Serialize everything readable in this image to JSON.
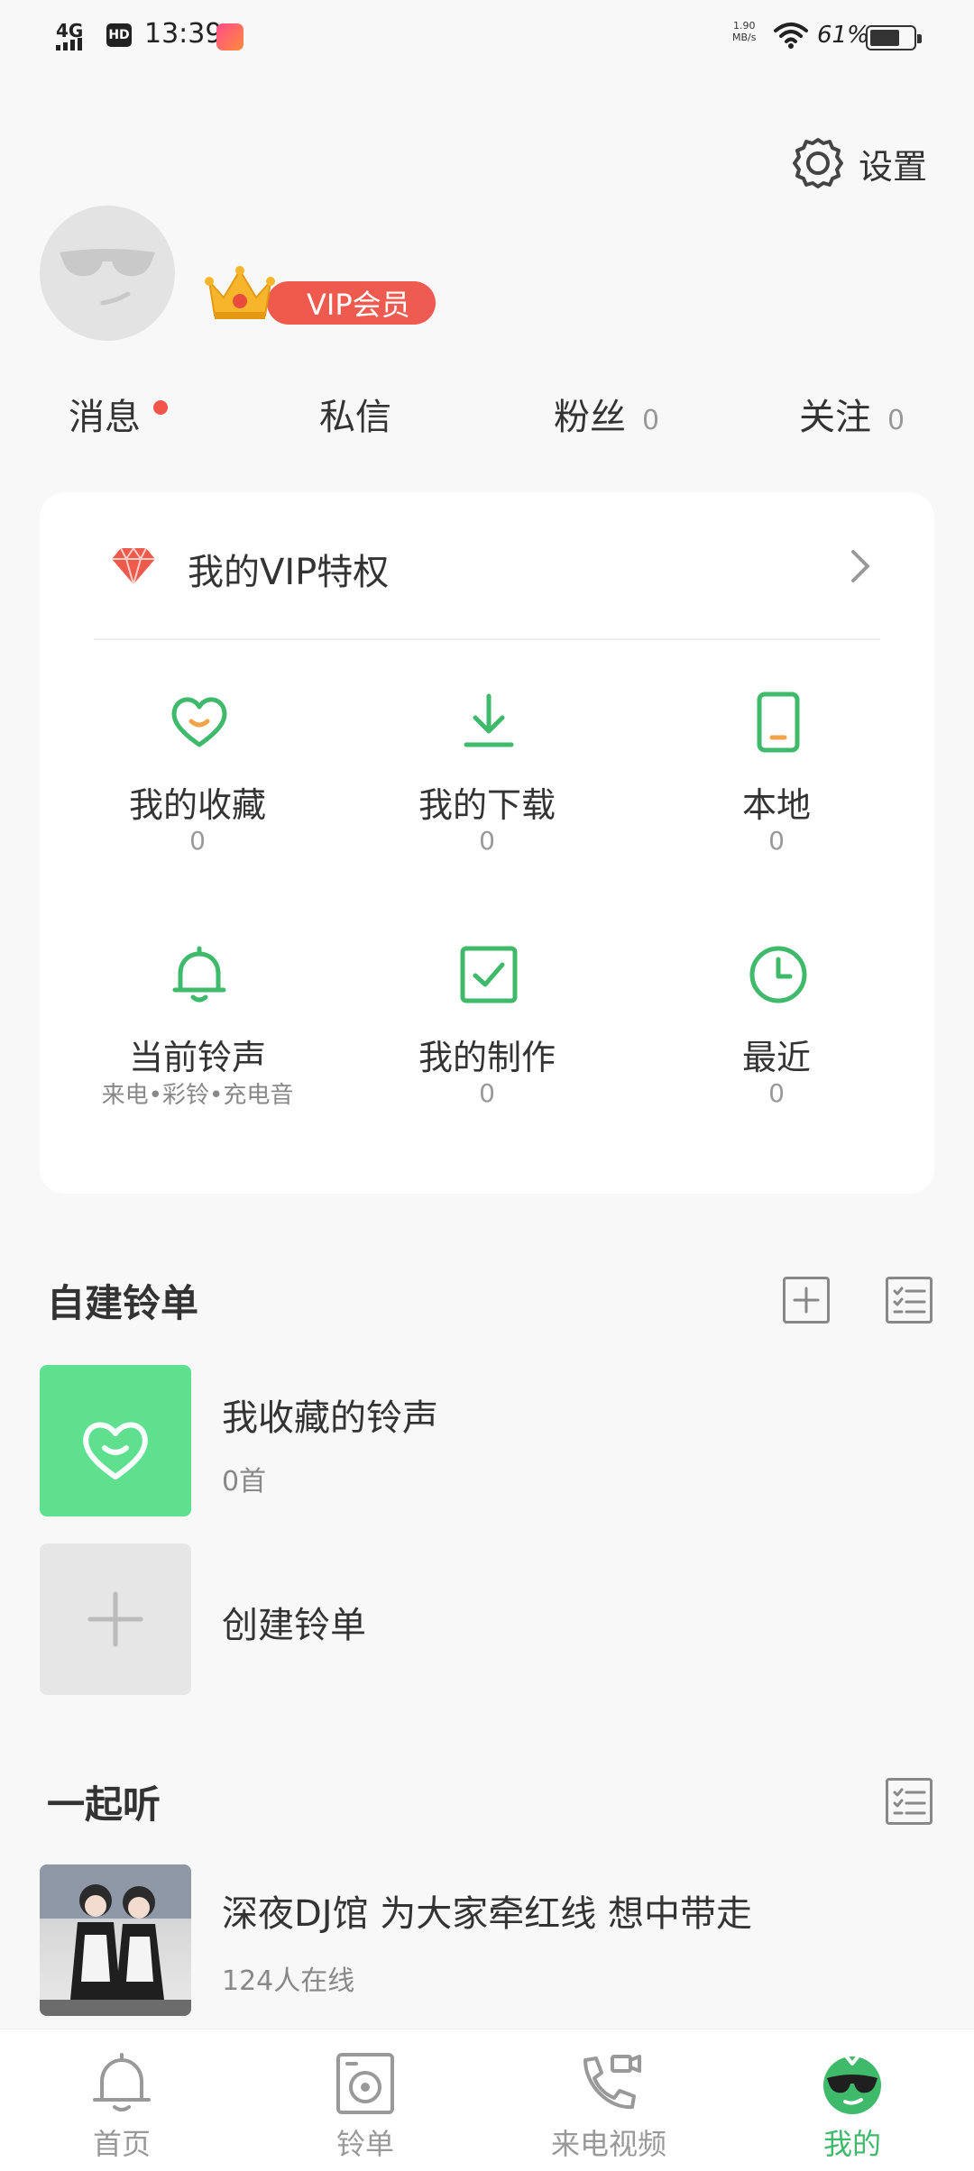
{
  "status_bar": {
    "network": "4G",
    "hd_label": "HD",
    "time": "13:39",
    "speed_value": "1.90",
    "speed_unit": "MB/s",
    "battery_pct": "61%"
  },
  "header": {
    "settings_label": "设置",
    "vip_label": "VIP会员"
  },
  "stats": [
    {
      "label": "消息",
      "count": ""
    },
    {
      "label": "私信",
      "count": ""
    },
    {
      "label": "粉丝",
      "count": "0"
    },
    {
      "label": "关注",
      "count": "0"
    }
  ],
  "card": {
    "vip_privilege_label": "我的VIP特权",
    "tiles": [
      {
        "name": "我的收藏",
        "count": "0",
        "icon": "heart-icon"
      },
      {
        "name": "我的下载",
        "count": "0",
        "icon": "download-icon"
      },
      {
        "name": "本地",
        "count": "0",
        "icon": "phone-icon"
      },
      {
        "name": "当前铃声",
        "sub": "来电•彩铃•充电音",
        "icon": "bell-icon"
      },
      {
        "name": "我的制作",
        "count": "0",
        "icon": "checkbox-icon"
      },
      {
        "name": "最近",
        "count": "0",
        "icon": "clock-icon"
      }
    ]
  },
  "custom_lists": {
    "title": "自建铃单",
    "items": [
      {
        "title": "我收藏的铃声",
        "sub": "0首"
      },
      {
        "title": "创建铃单"
      }
    ]
  },
  "listen_together": {
    "title": "一起听",
    "items": [
      {
        "title": "深夜DJ馆 为大家牵红线 想中带走",
        "sub": "124人在线"
      }
    ]
  },
  "bottom_nav": [
    {
      "label": "首页",
      "icon": "bell-icon"
    },
    {
      "label": "铃单",
      "icon": "disc-icon"
    },
    {
      "label": "来电视频",
      "icon": "video-call-icon"
    },
    {
      "label": "我的",
      "icon": "profile-icon",
      "active": true
    }
  ],
  "colors": {
    "accent_green": "#3fb96a",
    "vip_red": "#ee5b52",
    "tile_green": "#5ee08f"
  }
}
